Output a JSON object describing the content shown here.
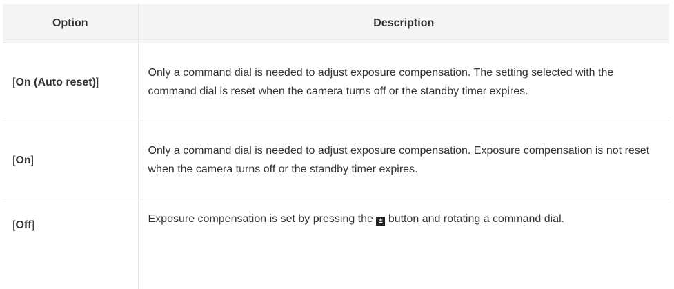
{
  "table": {
    "headers": {
      "option": "Option",
      "description": "Description"
    },
    "rows": [
      {
        "option_open": "[",
        "option": "On (Auto reset)",
        "option_close": "]",
        "description": "Only a command dial is needed to adjust exposure compensation. The setting selected with the command dial is reset when the camera turns off or the standby timer expires."
      },
      {
        "option_open": "[",
        "option": "On",
        "option_close": "]",
        "description": "Only a command dial is needed to adjust exposure compensation. Exposure compensation is not reset when the camera turns off or the standby timer expires."
      },
      {
        "option_open": "[",
        "option": "Off",
        "option_close": "]",
        "description_before": "Exposure compensation is set by pressing the",
        "icon": "exposure-compensation-icon",
        "description_after": "button and rotating a command dial."
      }
    ]
  }
}
